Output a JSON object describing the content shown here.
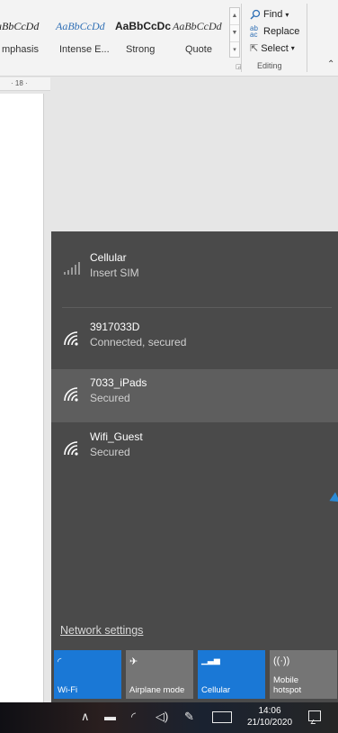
{
  "ribbon": {
    "styles": [
      {
        "sample": "aBbCcDd",
        "name": "mphasis"
      },
      {
        "sample": "AaBbCcDd",
        "name": "Intense E..."
      },
      {
        "sample": "AaBbCcDc",
        "name": "Strong"
      },
      {
        "sample": "AaBbCcDd",
        "name": "Quote"
      }
    ],
    "editing": {
      "find_label": "Find",
      "replace_label": "Replace",
      "select_label": "Select",
      "group_label": "Editing"
    }
  },
  "ruler": {
    "text": "· 18 ·"
  },
  "network": {
    "cellular": {
      "name": "Cellular",
      "status": "Insert SIM"
    },
    "wifi": [
      {
        "name": "3917033D",
        "status": "Connected, secured"
      },
      {
        "name": "7033_iPads",
        "status": "Secured"
      },
      {
        "name": "Wifi_Guest",
        "status": "Secured"
      }
    ],
    "settings_link": "Network settings",
    "quick_actions": [
      {
        "label": "Wi-Fi",
        "icon": "wifi-icon",
        "active": true
      },
      {
        "label": "Airplane mode",
        "icon": "airplane-icon",
        "active": false
      },
      {
        "label": "Cellular",
        "icon": "cellular-icon",
        "active": true
      },
      {
        "label": "Mobile hotspot",
        "icon": "hotspot-icon",
        "active": false
      }
    ]
  },
  "taskbar": {
    "time": "14:06",
    "date": "21/10/2020"
  },
  "colors": {
    "accent": "#1a78d6",
    "flyout_bg": "#4a4a4a",
    "selected_bg": "#5e5e5e"
  }
}
